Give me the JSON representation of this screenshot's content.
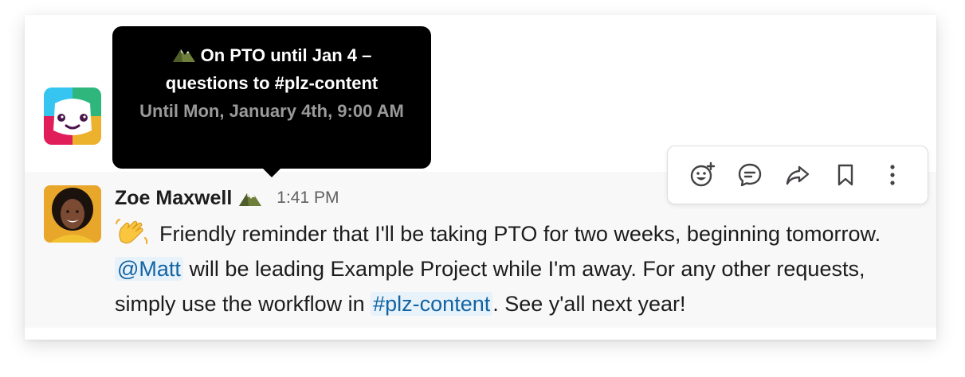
{
  "tooltip": {
    "status_text": "On PTO until Jan 4 – questions to #plz-content",
    "until_text": "Until Mon, January 4th, 9:00 AM",
    "emoji_icon": "mountain-emoji"
  },
  "message": {
    "sender": "Zoe Maxwell",
    "status_emoji_icon": "mountain-emoji",
    "timestamp": "1:41 PM",
    "emoji_icon": "waving-hand-emoji",
    "text_1": "Friendly reminder that I'll be taking PTO for two weeks, beginning tomorrow.",
    "mention": "@Matt",
    "text_2": "will be leading Example Project while I'm away. For any other requests, simply use the workflow in",
    "channel": "#plz-content",
    "text_3": ". See y'all next year!"
  },
  "actions": [
    {
      "name": "add-reaction",
      "icon": "emoji-add-icon"
    },
    {
      "name": "reply-in-thread",
      "icon": "thread-reply-icon"
    },
    {
      "name": "share-message",
      "icon": "share-arrow-icon"
    },
    {
      "name": "save-message",
      "icon": "bookmark-icon"
    },
    {
      "name": "more-actions",
      "icon": "more-vertical-icon"
    }
  ],
  "colors": {
    "link": "#1264a3",
    "link_bg": "#e8f2fa",
    "tooltip_bg": "#000000",
    "hover_bg": "#f8f8f8"
  }
}
